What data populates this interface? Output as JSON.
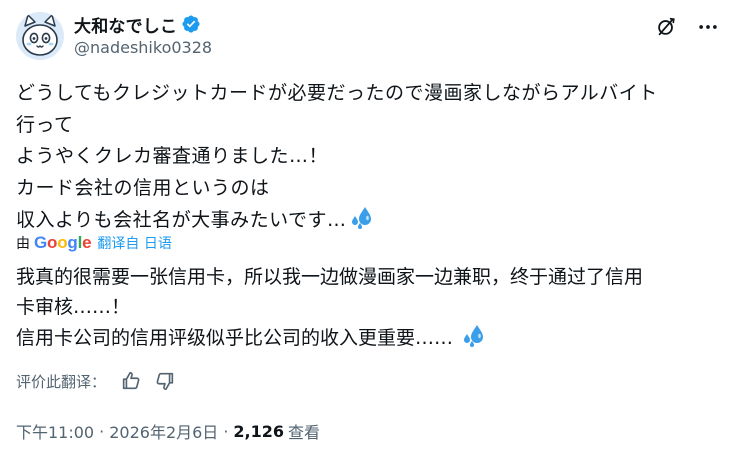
{
  "author": {
    "display_name": "大和なでしこ",
    "handle": "@nadeshiko0328",
    "avatar_icon": "cat-avatar-icon",
    "verified_icon": "verified-badge-icon"
  },
  "header_actions": {
    "grok_icon": "grok-icon",
    "more_icon": "more-options-icon"
  },
  "original_text": {
    "lines": [
      "どうしてもクレジットカードが必要だったので漫画家しながらアルバイト",
      "行って",
      "ようやくクレカ審査通りました…！",
      "カード会社の信用というのは",
      "収入よりも会社名が大事みたいです…"
    ]
  },
  "translation_bar": {
    "by_label": "由",
    "provider_logo": "Google",
    "translated_from": "翻译自 日语"
  },
  "translated_text": {
    "lines": [
      "我真的很需要一张信用卡，所以我一边做漫画家一边兼职，终于通过了信用",
      "卡审核……！",
      "信用卡公司的信用评级似乎比公司的收入更重要……"
    ]
  },
  "rate_translation": {
    "label": "评价此翻译：",
    "thumbs_up_icon": "thumbs-up-icon",
    "thumbs_down_icon": "thumbs-down-icon"
  },
  "meta": {
    "time": "下午11:00",
    "separator": "·",
    "date": "2026年2月6日",
    "views_count": "2,126",
    "views_label": "查看"
  },
  "colors": {
    "text_primary": "#0f1419",
    "text_secondary": "#536471",
    "link_blue": "#1d9bf0",
    "verified_blue": "#1d9bf0",
    "emoji_blue": "#3b9ee8"
  }
}
